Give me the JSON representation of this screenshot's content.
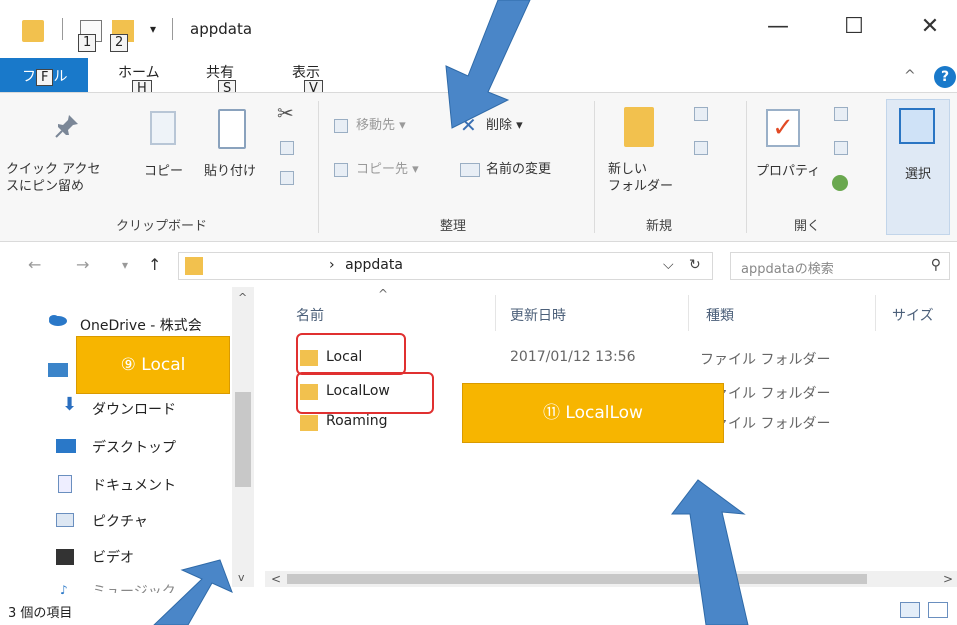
{
  "window": {
    "title": "appdata",
    "minimize": "—",
    "maximize": "☐",
    "close": "✕",
    "qa_dropdown": "▾"
  },
  "keytips": {
    "qa1": "1",
    "qa2": "2",
    "file": "F",
    "home": "H",
    "share": "S",
    "view": "V"
  },
  "tabs": {
    "file_pre": "フ",
    "file_post": "ル",
    "home": "ホーム",
    "share": "共有",
    "view": "表示",
    "collapse": "^",
    "help": "?"
  },
  "ribbon": {
    "clipboard": {
      "pin_line1": "クイック アクセ",
      "pin_line2": "スにピン留め",
      "copy": "コピー",
      "paste": "貼り付け",
      "label": "クリップボード"
    },
    "organize": {
      "move_to": "移動先 ▾",
      "copy_to": "コピー先 ▾",
      "delete": "削除 ▾",
      "rename": "名前の変更",
      "label": "整理"
    },
    "new": {
      "new_folder_line1": "新しい",
      "new_folder_line2": "フォルダー",
      "label": "新規"
    },
    "open": {
      "properties": "プロパティ",
      "label": "開く"
    },
    "select": {
      "label": "選択"
    }
  },
  "address": {
    "back": "←",
    "forward": "→",
    "recent": "▾",
    "up": "↑",
    "sep": "›",
    "path": "appdata",
    "dropdown": "⌵",
    "refresh": "↻",
    "search_placeholder": "appdataの検索",
    "search_icon": "⚲"
  },
  "navpane": {
    "items": [
      {
        "label": "OneDrive - 株式会"
      },
      {
        "label": "ダウンロード"
      },
      {
        "label": "デスクトップ"
      },
      {
        "label": "ドキュメント"
      },
      {
        "label": "ピクチャ"
      },
      {
        "label": "ビデオ"
      },
      {
        "label": "ミュージック"
      }
    ]
  },
  "columns": {
    "name": "名前",
    "date": "更新日時",
    "type": "種類",
    "size": "サイズ",
    "sort": "^"
  },
  "files": [
    {
      "name": "Local",
      "date": "2017/01/12 13:56",
      "type": "ファイル フォルダー"
    },
    {
      "name": "LocalLow",
      "type": "ファイル フォルダー"
    },
    {
      "name": "Roaming",
      "type": "ファイル フォルダー"
    }
  ],
  "scroll": {
    "left": "<",
    "right": ">",
    "up": "^",
    "down": "v"
  },
  "status": {
    "count": "3 個の項目"
  },
  "callouts": {
    "local": "⑨ Local",
    "locallow": "⑪ LocalLow"
  },
  "colors": {
    "callout": "#f7b500",
    "arrow": "#4a86c8",
    "highlight": "#e03030",
    "file_tab": "#1979ca",
    "folder": "#f2c14e"
  }
}
